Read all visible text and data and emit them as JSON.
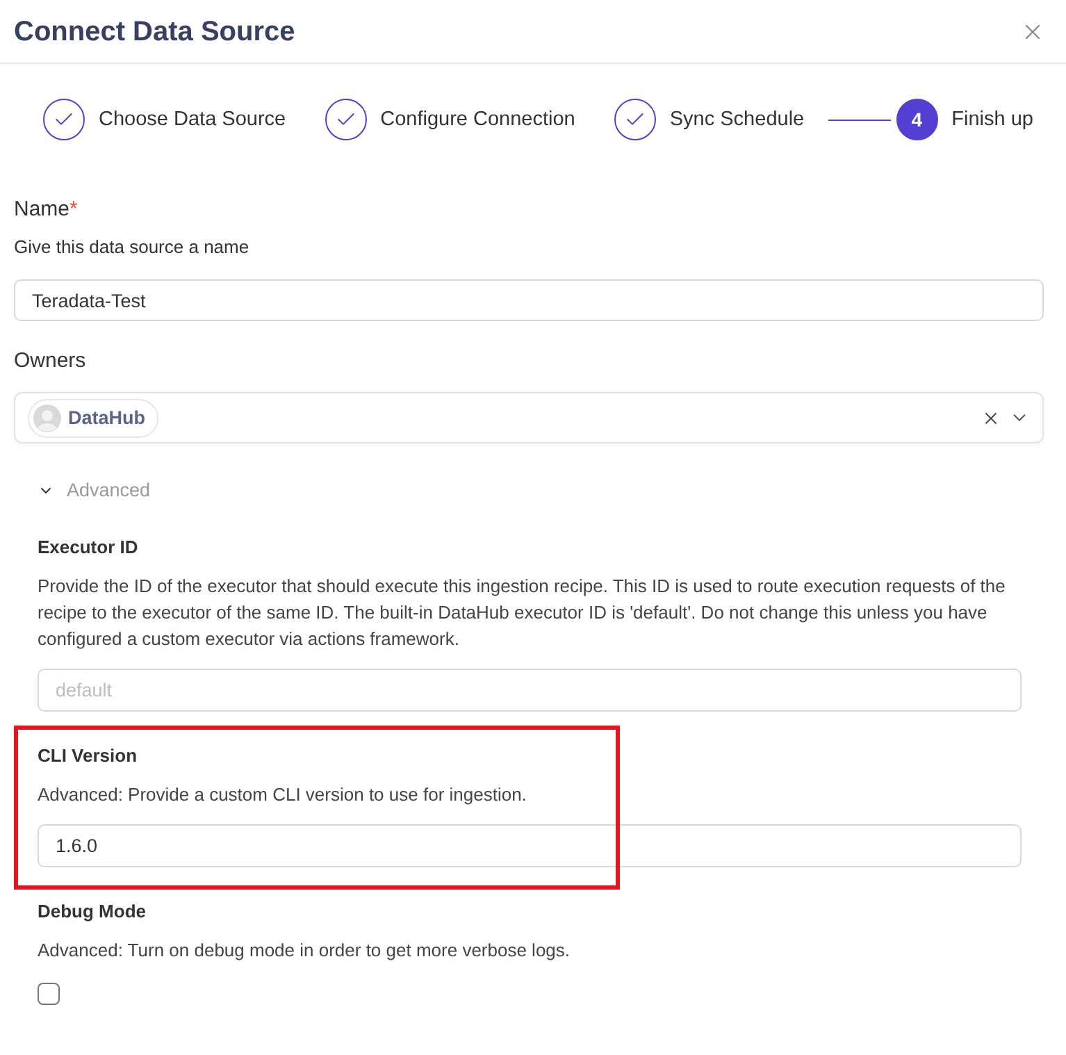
{
  "dialog": {
    "title": "Connect Data Source"
  },
  "steps": [
    {
      "label": "Choose Data Source",
      "completed": true,
      "selected": false
    },
    {
      "label": "Configure Connection",
      "completed": true,
      "selected": false
    },
    {
      "label": "Sync Schedule",
      "completed": true,
      "selected": false
    },
    {
      "label": "Finish up",
      "completed": false,
      "selected": true,
      "number": "4"
    }
  ],
  "name_field": {
    "label": "Name",
    "required_mark": "*",
    "description": "Give this data source a name",
    "value": "Teradata-Test"
  },
  "owners_field": {
    "label": "Owners",
    "tags": [
      {
        "label": "DataHub"
      }
    ]
  },
  "advanced": {
    "label": "Advanced",
    "expanded": true,
    "fields": [
      {
        "kind": "text",
        "label": "Executor ID",
        "description": "Provide the ID of the executor that should execute this ingestion recipe. This ID is used to route execution requests of the recipe to the executor of the same ID. The built-in DataHub executor ID is 'default'. Do not change this unless you have configured a custom executor via actions framework.",
        "placeholder": "default",
        "highlighted": false
      },
      {
        "kind": "text",
        "label": "CLI Version",
        "description": "Advanced: Provide a custom CLI version to use for ingestion.",
        "value": "1.6.0",
        "highlighted": true
      },
      {
        "kind": "checkbox",
        "label": "Debug Mode",
        "description": "Advanced: Turn on debug mode in order to get more verbose logs.",
        "checked": false,
        "highlighted": false
      }
    ]
  }
}
